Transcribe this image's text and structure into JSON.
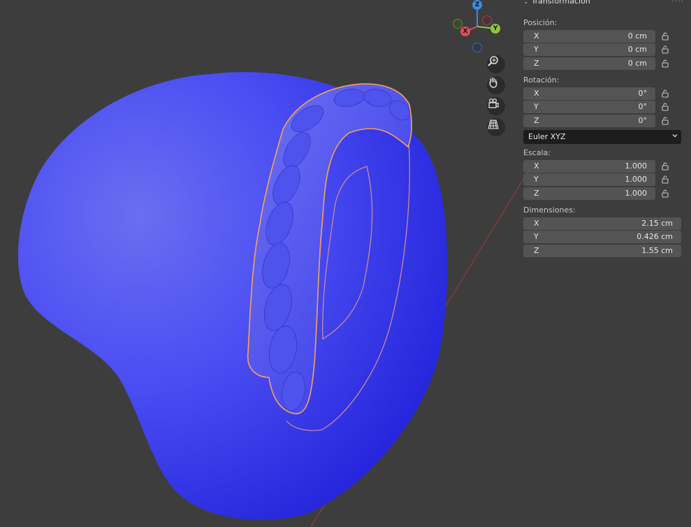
{
  "viewport": {
    "background": "#3d3d3d",
    "mesh_color": "#3b3bf5",
    "selection_outline": "#f5a45c",
    "gizmo": {
      "x_label": "X",
      "y_label": "Y",
      "z_label": "Z"
    },
    "nav_buttons": [
      "zoom-icon",
      "hand-pan-icon",
      "camera-icon",
      "perspective-grid-icon"
    ]
  },
  "panel": {
    "header": "Transformación",
    "position": {
      "label": "Posición:",
      "rows": [
        {
          "axis": "X",
          "value": "0 cm"
        },
        {
          "axis": "Y",
          "value": "0 cm"
        },
        {
          "axis": "Z",
          "value": "0 cm"
        }
      ]
    },
    "rotation": {
      "label": "Rotación:",
      "rows": [
        {
          "axis": "X",
          "value": "0°"
        },
        {
          "axis": "Y",
          "value": "0°"
        },
        {
          "axis": "Z",
          "value": "0°"
        }
      ],
      "mode": "Euler XYZ"
    },
    "scale": {
      "label": "Escala:",
      "rows": [
        {
          "axis": "X",
          "value": "1.000"
        },
        {
          "axis": "Y",
          "value": "1.000"
        },
        {
          "axis": "Z",
          "value": "1.000"
        }
      ]
    },
    "dimensions": {
      "label": "Dimensiones:",
      "rows": [
        {
          "axis": "X",
          "value": "2.15 cm"
        },
        {
          "axis": "Y",
          "value": "0.426 cm"
        },
        {
          "axis": "Z",
          "value": "1.55 cm"
        }
      ]
    }
  }
}
